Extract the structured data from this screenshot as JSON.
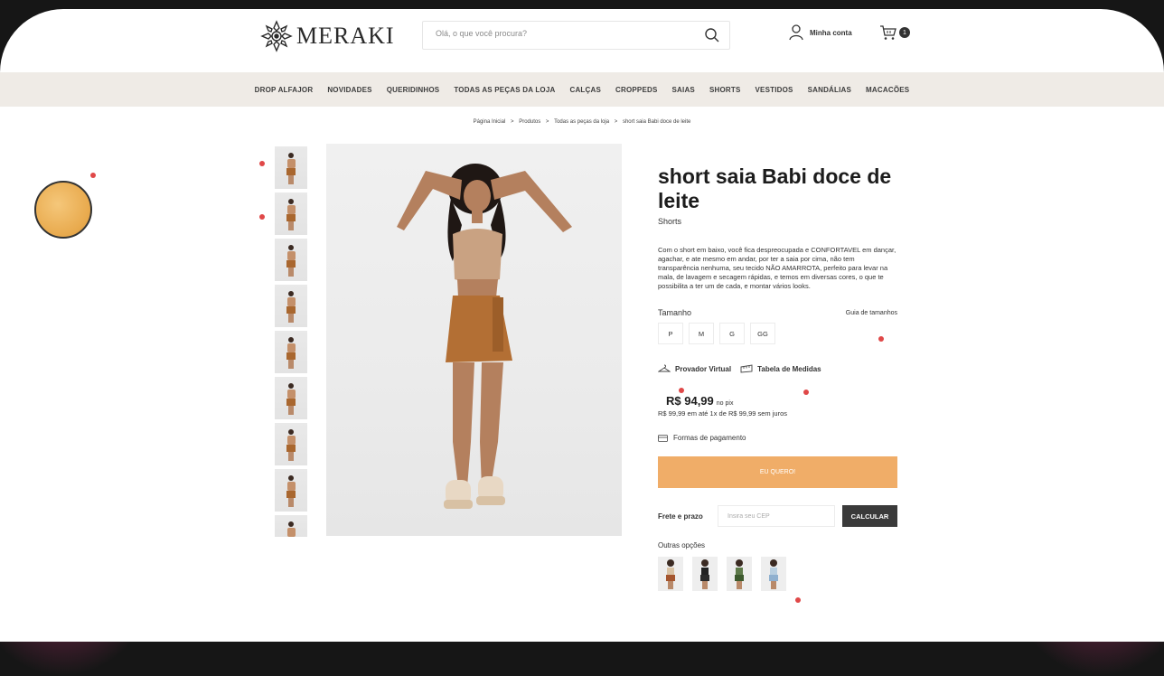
{
  "brand": {
    "name": "MERAKI"
  },
  "search": {
    "placeholder": "Olá, o que você procura?"
  },
  "account": {
    "label": "Minha conta"
  },
  "cart": {
    "count": "1"
  },
  "nav": {
    "items": [
      "DROP ALFAJOR",
      "NOVIDADES",
      "QUERIDINHOS",
      "TODAS AS PEÇAS DA LOJA",
      "CALÇAS",
      "CROPPEDS",
      "SAIAS",
      "SHORTS",
      "VESTIDOS",
      "SANDÁLIAS",
      "MACACÕES"
    ]
  },
  "breadcrumb": {
    "items": [
      "Página Inicial",
      "Produtos",
      "Todas as peças da loja",
      "short saia Babi doce de leite"
    ],
    "separator": ">"
  },
  "product": {
    "title": "short saia Babi doce de leite",
    "category": "Shorts",
    "description": "Com o short em baixo, você fica despreocupada e CONFORTAVEL em dançar, agachar, e ate mesmo em andar, por ter a saia por cima, não tem transparência nenhuma, seu tecido NÃO AMARROTA, perfeito para levar na mala, de lavagem e secagem rápidas, e temos em diversas cores, o que te possibilita a ter um de cada, e montar vários looks.",
    "size_label": "Tamanho",
    "size_guide": "Guia de tamanhos",
    "sizes": [
      "P",
      "M",
      "G",
      "GG"
    ],
    "virtual_fitting": "Provador Virtual",
    "measure_table": "Tabela de Medidas",
    "price": "R$ 94,99",
    "price_suffix": "no pix",
    "installments": "R$ 99,99 em até 1x de R$ 99,99 sem juros",
    "payment_methods": "Formas de pagamento",
    "buy_label": "EU QUERO!",
    "shipping_label": "Frete e prazo",
    "cep_placeholder": "Insira seu CEP",
    "calculate_label": "CALCULAR",
    "other_options_label": "Outras opções"
  },
  "colors": {
    "accent": "#f0ad68",
    "nav_bg": "#efebe6",
    "dark_button": "#3a3a3a"
  }
}
